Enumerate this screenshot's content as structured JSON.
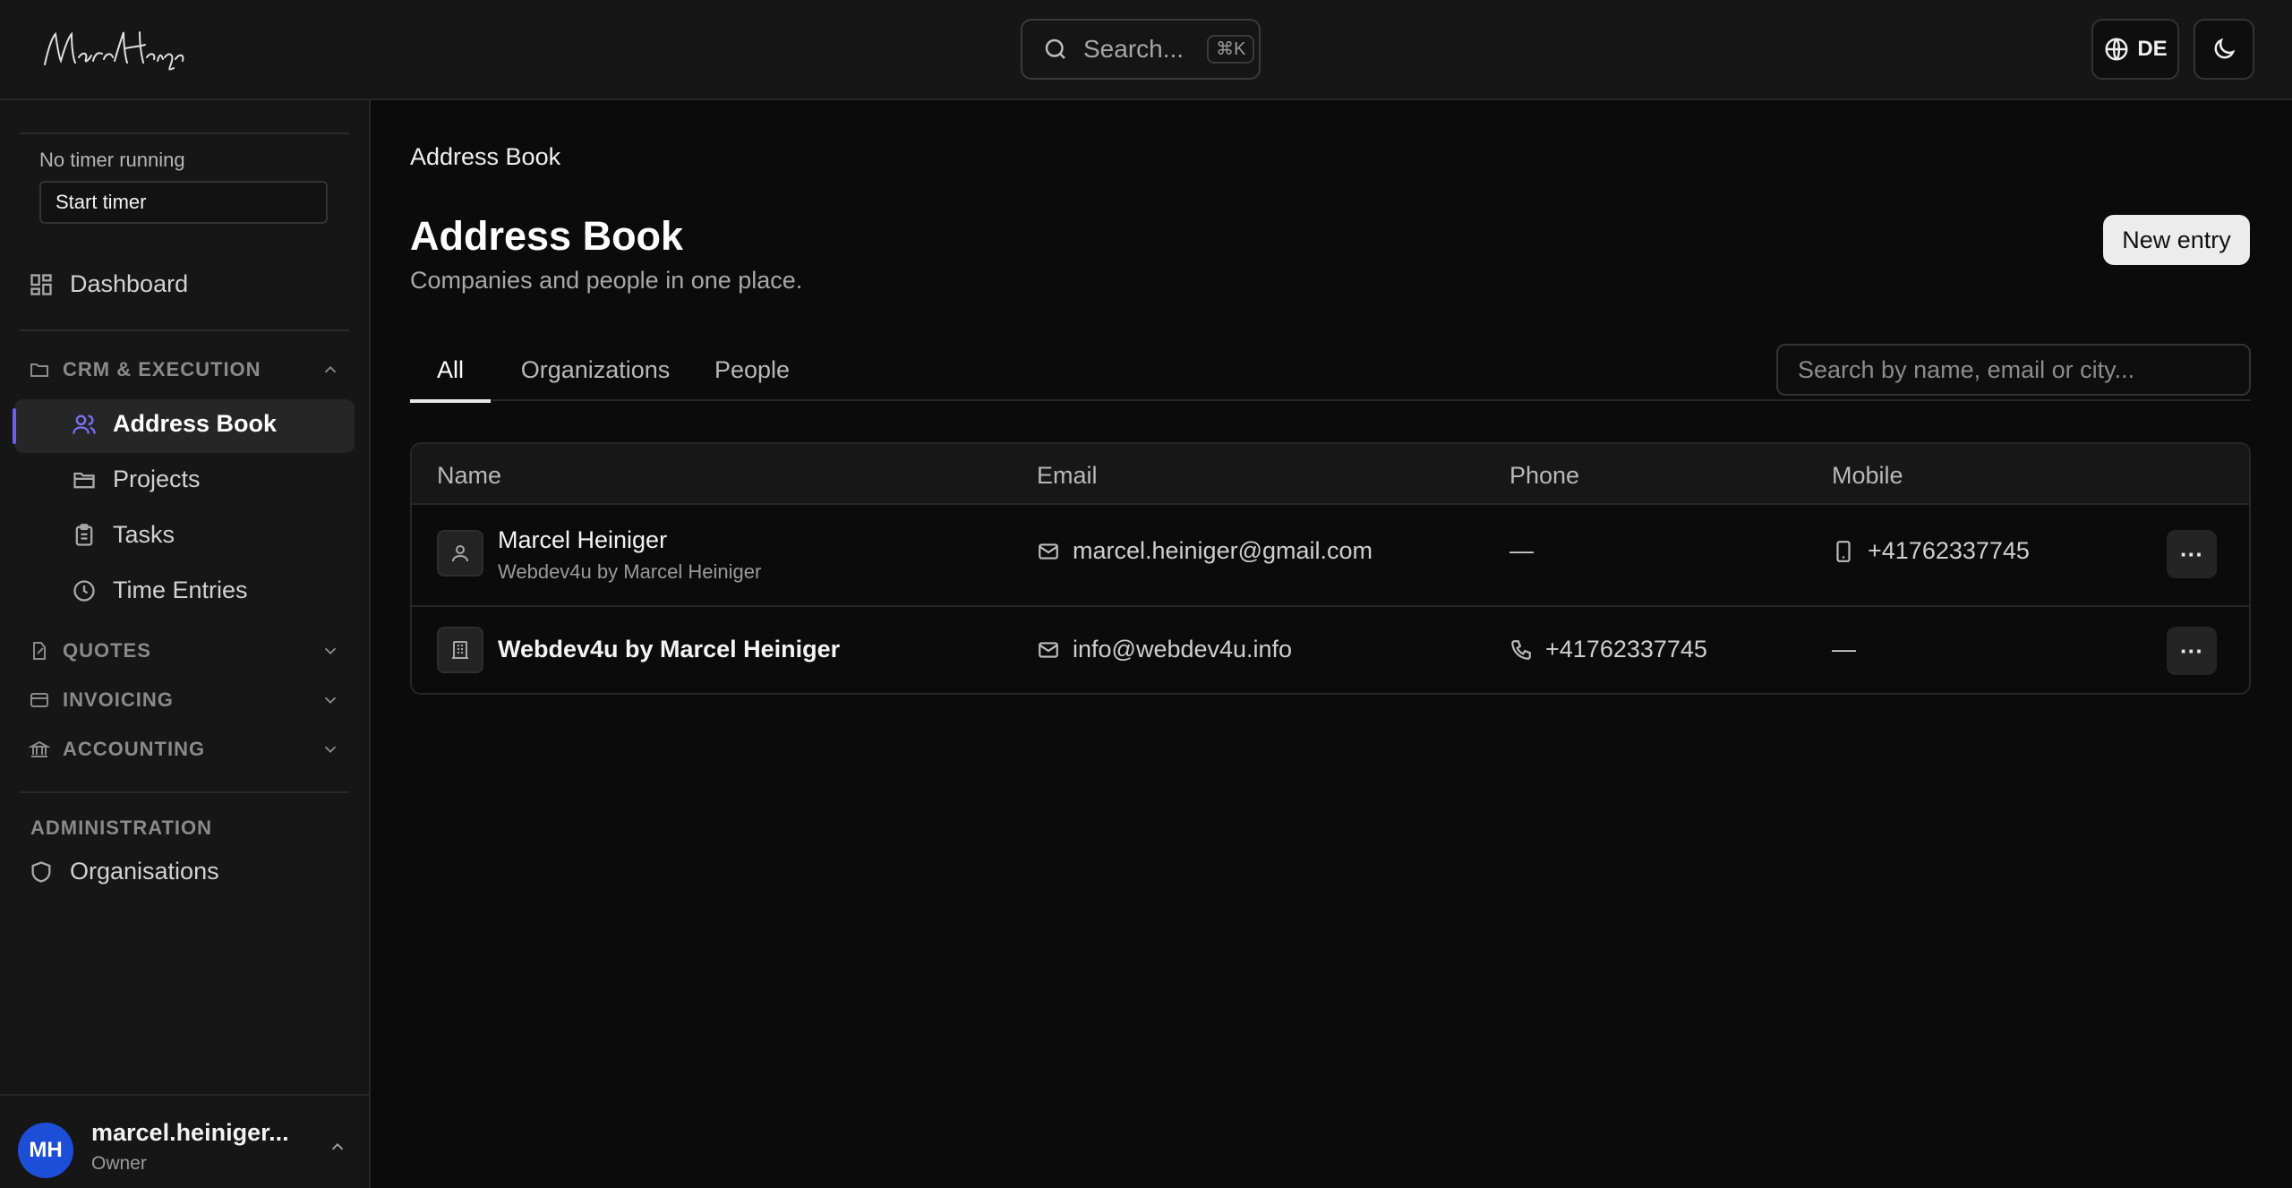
{
  "header": {
    "logo_text": "Marcel Heiniger",
    "search_placeholder": "Search...",
    "search_shortcut": "⌘K",
    "language": "DE"
  },
  "sidebar": {
    "timer_status": "No timer running",
    "timer_button": "Start timer",
    "dashboard": "Dashboard",
    "sections": [
      {
        "label": "CRM & EXECUTION",
        "expanded": true,
        "items": [
          "Address Book",
          "Projects",
          "Tasks",
          "Time Entries"
        ]
      },
      {
        "label": "QUOTES",
        "expanded": false
      },
      {
        "label": "INVOICING",
        "expanded": false
      },
      {
        "label": "ACCOUNTING",
        "expanded": false
      }
    ],
    "admin_label": "ADMINISTRATION",
    "admin_item": "Organisations",
    "user": {
      "initials": "MH",
      "name": "marcel.heiniger...",
      "role": "Owner"
    },
    "accent_color": "#6d5ff5"
  },
  "main": {
    "breadcrumb": "Address Book",
    "title": "Address Book",
    "subtitle": "Companies and people in one place.",
    "new_entry": "New entry",
    "tabs": [
      "All",
      "Organizations",
      "People"
    ],
    "active_tab": "All",
    "table_search_placeholder": "Search by name, email or city...",
    "columns": [
      "Name",
      "Email",
      "Phone",
      "Mobile"
    ],
    "rows": [
      {
        "type": "person",
        "name": "Marcel Heiniger",
        "org": "Webdev4u by Marcel Heiniger",
        "email": "marcel.heiniger@gmail.com",
        "phone": "—",
        "mobile": "+41762337745"
      },
      {
        "type": "organization",
        "name": "Webdev4u by Marcel Heiniger",
        "org": "",
        "email": "info@webdev4u.info",
        "phone": "+41762337745",
        "mobile": "—"
      }
    ],
    "more_label": "···"
  }
}
